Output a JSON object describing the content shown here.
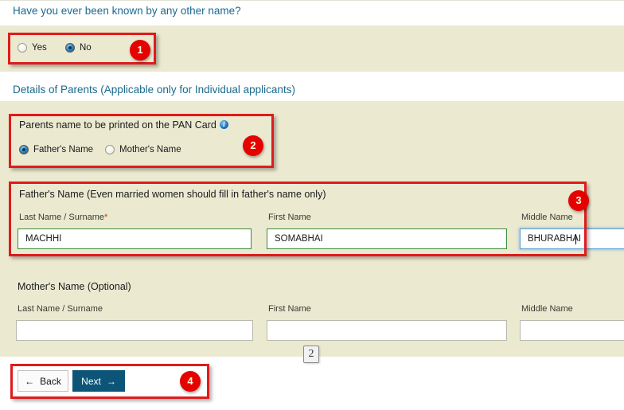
{
  "form": {
    "other_name_question": "Have you ever been known by any other name?",
    "other_name_options": [
      {
        "label": "Yes",
        "checked": false
      },
      {
        "label": "No",
        "checked": true
      }
    ],
    "parents_section_heading": "Details of Parents (Applicable only for Individual applicants)",
    "print_on_card": {
      "title": "Parents name to be printed on the PAN Card",
      "info_icon": "info-icon",
      "options": [
        {
          "label": "Father's Name",
          "checked": true
        },
        {
          "label": "Mother's Name",
          "checked": false
        }
      ]
    },
    "father": {
      "title": "Father's Name (Even married women should fill in father's name only)",
      "last_name_label": "Last Name / Surname",
      "last_name_required_mark": "*",
      "last_name_value": "MACHHI",
      "first_name_label": "First Name",
      "first_name_value": "SOMABHAI",
      "middle_name_label": "Middle Name",
      "middle_name_value": "BHURABHAI"
    },
    "mother": {
      "title": "Mother's Name (Optional)",
      "last_name_label": "Last Name / Surname",
      "last_name_value": "",
      "last_name_placeholder": "",
      "first_name_label": "First Name",
      "first_name_value": "",
      "first_name_placeholder": "",
      "middle_name_label": "Middle Name",
      "middle_name_value": "",
      "middle_name_placeholder": ""
    }
  },
  "page_chip": {
    "label": "2"
  },
  "footer": {
    "back_label": "Back",
    "back_arrow": "←",
    "next_label": "Next",
    "next_arrow": "→"
  },
  "annotations": [
    {
      "badge": "1"
    },
    {
      "badge": "2"
    },
    {
      "badge": "3"
    },
    {
      "badge": "4"
    }
  ],
  "colors": {
    "panel_beige": "#ebe9d0",
    "heading_teal": "#1b6a8d",
    "annotation_red": "#e01b1b",
    "badge_red": "#e60000",
    "filled_field_border": "#3f8a3f",
    "focused_field_border": "#5a9fd4",
    "next_button_bg": "#0d5578"
  }
}
